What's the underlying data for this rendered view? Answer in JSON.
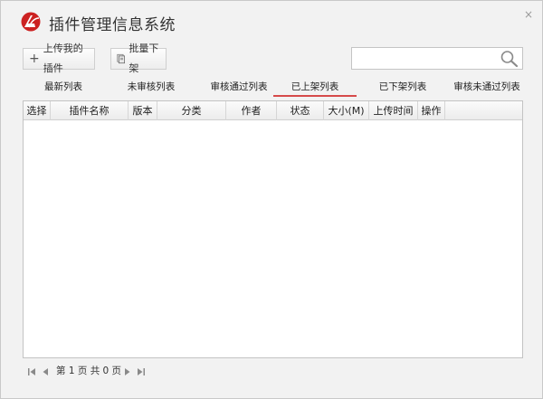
{
  "app": {
    "title": "插件管理信息系统",
    "close_label": "×"
  },
  "toolbar": {
    "upload_label": "上传我的插件",
    "batch_offline_label": "批量下架"
  },
  "search": {
    "placeholder": "",
    "value": ""
  },
  "tabs": [
    {
      "label": "最新列表",
      "active": false
    },
    {
      "label": "未审核列表",
      "active": false
    },
    {
      "label": "审核通过列表",
      "active": false
    },
    {
      "label": "已上架列表",
      "active": true
    },
    {
      "label": "已下架列表",
      "active": false
    },
    {
      "label": "审核未通过列表",
      "active": false
    }
  ],
  "table": {
    "columns": [
      "选择",
      "插件名称",
      "版本",
      "分类",
      "作者",
      "状态",
      "大小(M)",
      "上传时间",
      "操作"
    ],
    "rows": []
  },
  "pager": {
    "text": "第 1 页 共 0 页"
  },
  "colors": {
    "accent": "#d64a4a",
    "logo_red": "#cc2222",
    "border": "#c3c3c3"
  }
}
